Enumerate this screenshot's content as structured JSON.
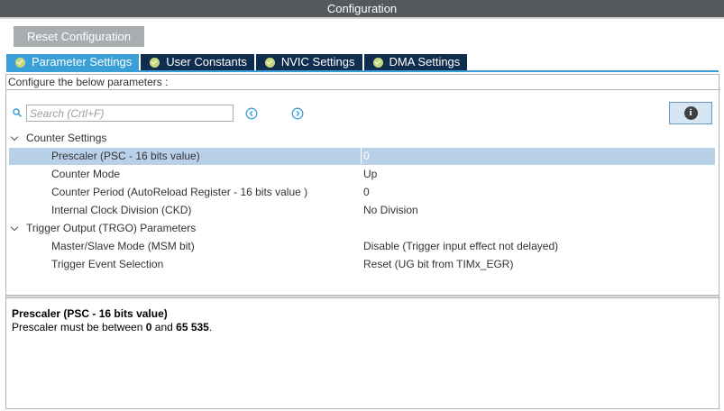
{
  "window": {
    "title": "Configuration"
  },
  "toolbar": {
    "reset_label": "Reset Configuration"
  },
  "tabs": [
    {
      "label": "Parameter Settings",
      "active": true
    },
    {
      "label": "User Constants",
      "active": false
    },
    {
      "label": "NVIC Settings",
      "active": false
    },
    {
      "label": "DMA Settings",
      "active": false
    }
  ],
  "hint": "Configure the below parameters :",
  "search": {
    "placeholder": "Search (Crtl+F)"
  },
  "groups": [
    {
      "label": "Counter Settings",
      "params": [
        {
          "label": "Prescaler (PSC - 16 bits value)",
          "value": "0",
          "selected": true
        },
        {
          "label": "Counter Mode",
          "value": "Up"
        },
        {
          "label": "Counter Period (AutoReload Register - 16 bits value )",
          "value": "0"
        },
        {
          "label": "Internal Clock Division (CKD)",
          "value": "No Division"
        }
      ]
    },
    {
      "label": "Trigger Output (TRGO) Parameters",
      "params": [
        {
          "label": "Master/Slave Mode (MSM bit)",
          "value": "Disable (Trigger input effect not delayed)"
        },
        {
          "label": "Trigger Event Selection",
          "value": "Reset (UG bit from TIMx_EGR)"
        }
      ]
    }
  ],
  "description": {
    "title": "Prescaler (PSC - 16 bits value)",
    "text_prefix": "Prescaler must be between ",
    "min": "0",
    "text_mid": " and ",
    "max": "65 535",
    "text_suffix": "."
  },
  "icons": {
    "tab_check": "check-circle-icon",
    "search": "search-icon",
    "prev": "circle-chevron-left-icon",
    "next": "circle-chevron-right-icon",
    "info": "info-icon",
    "group_toggle": "chevron-down-icon"
  },
  "colors": {
    "title_bar": "#55595c",
    "tab_active": "#3a9fd6",
    "tab_inactive": "#0f2d4f",
    "tab_check": "#c6d87d",
    "row_selected": "#b8d0e8",
    "nav_icon": "#3a9fd6"
  }
}
